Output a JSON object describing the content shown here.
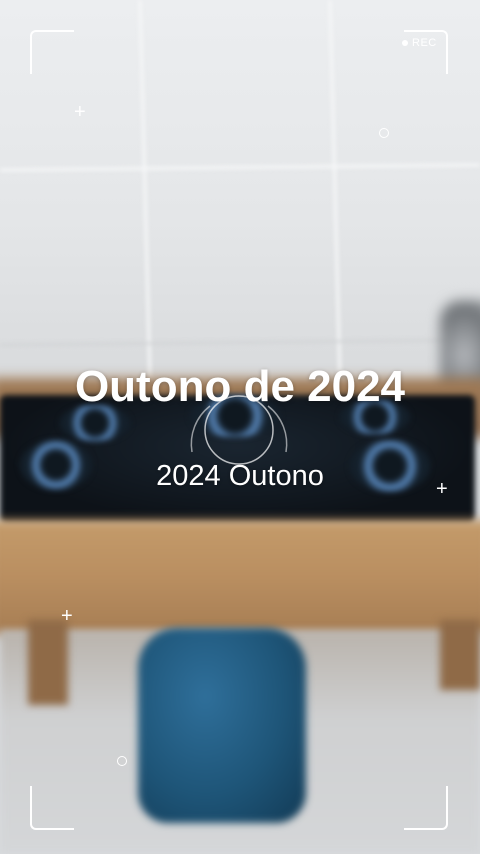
{
  "overlay": {
    "rec_label": "REC",
    "title": "Outono de 2024",
    "subtitle": "2024 Outono"
  },
  "icons": {
    "rec_indicator": "rec-dot-icon",
    "crosshair": "plus-icon",
    "marker": "ring-icon",
    "focus": "focus-ring-icon"
  },
  "colors": {
    "overlay_text": "#ffffff",
    "tank": "#1e5578",
    "counter": "#b98e60",
    "cooktop": "#0d1218",
    "flame": "#5a8ac0"
  }
}
